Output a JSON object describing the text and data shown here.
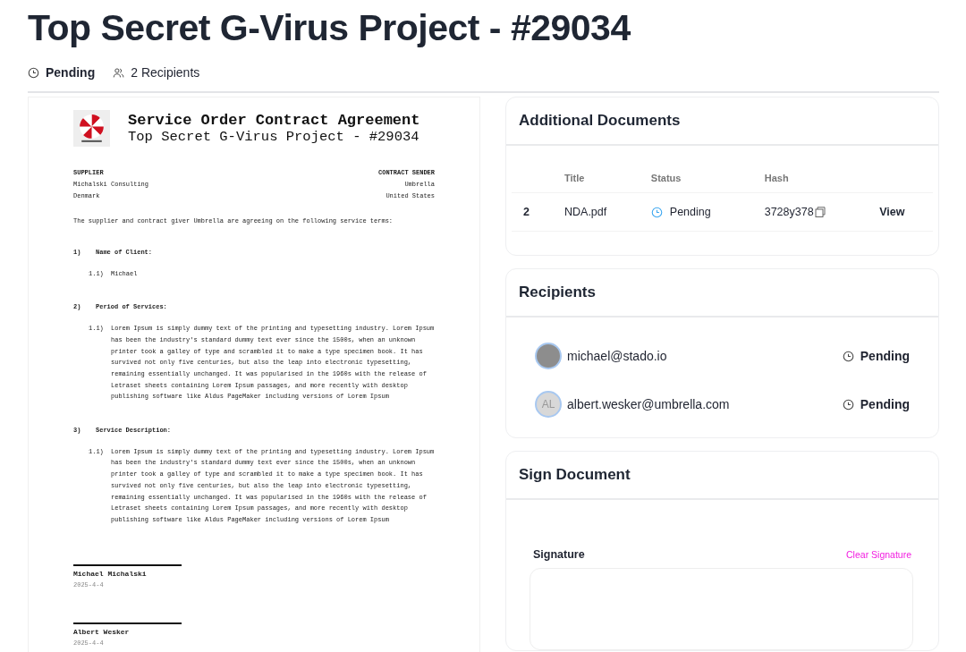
{
  "title": "Top Secret G-Virus Project - #29034",
  "meta": {
    "status": "Pending",
    "recipients": "2 Recipients"
  },
  "document": {
    "heading": "Service Order Contract Agreement",
    "subheading": "Top Secret G-Virus Project - #29034",
    "supplier": {
      "label": "SUPPLIER",
      "lines": [
        "Michalski Consulting",
        "Denmark"
      ]
    },
    "sender": {
      "label": "CONTRACT SENDER",
      "lines": [
        "Umbrella",
        "United States"
      ]
    },
    "intro": "The supplier and contract giver Umbrella are agreeing on the following service terms:",
    "sections": [
      {
        "number": "1)",
        "title": "Name of Client:",
        "items": [
          {
            "number": "1.1)",
            "text": "Michael"
          }
        ]
      },
      {
        "number": "2)",
        "title": "Period of Services:",
        "items": [
          {
            "number": "1.1)",
            "text": "Lorem Ipsum is simply dummy text of the printing and typesetting industry. Lorem Ipsum has been the industry's standard dummy text ever since the 1500s, when an unknown printer took a galley of type and scrambled it to make a type specimen book. It has survived not only five centuries, but also the leap into electronic typesetting, remaining essentially unchanged. It was popularised in the 1960s with the release of Letraset sheets containing Lorem Ipsum passages, and more recently with desktop publishing software like Aldus PageMaker including versions of Lorem Ipsum"
          }
        ]
      },
      {
        "number": "3)",
        "title": "Service Description:",
        "items": [
          {
            "number": "1.1)",
            "text": "Lorem Ipsum is simply dummy text of the printing and typesetting industry. Lorem Ipsum has been the industry's standard dummy text ever since the 1500s, when an unknown printer took a galley of type and scrambled it to make a type specimen book. It has survived not only five centuries, but also the leap into electronic typesetting, remaining essentially unchanged. It was popularised in the 1960s with the release of Letraset sheets containing Lorem Ipsum passages, and more recently with desktop publishing software like Aldus PageMaker including versions of Lorem Ipsum"
          }
        ]
      }
    ],
    "signatures": [
      {
        "name": "Michael Michalski",
        "date": "2025-4-4"
      },
      {
        "name": "Albert Wesker",
        "date": "2025-4-4"
      }
    ]
  },
  "additional_documents": {
    "title": "Additional Documents",
    "columns": [
      "Title",
      "Status",
      "Hash"
    ],
    "rows": [
      {
        "number": "2",
        "title": "NDA.pdf",
        "status": "Pending",
        "hash": "3728y378",
        "action": "View"
      }
    ]
  },
  "recipients": {
    "title": "Recipients",
    "items": [
      {
        "kind": "photo",
        "email": "michael@stado.io",
        "status": "Pending"
      },
      {
        "kind": "initials",
        "initials": "AL",
        "email": "albert.wesker@umbrella.com",
        "status": "Pending"
      }
    ]
  },
  "sign": {
    "title": "Sign Document",
    "label": "Signature",
    "clear": "Clear Signature"
  }
}
